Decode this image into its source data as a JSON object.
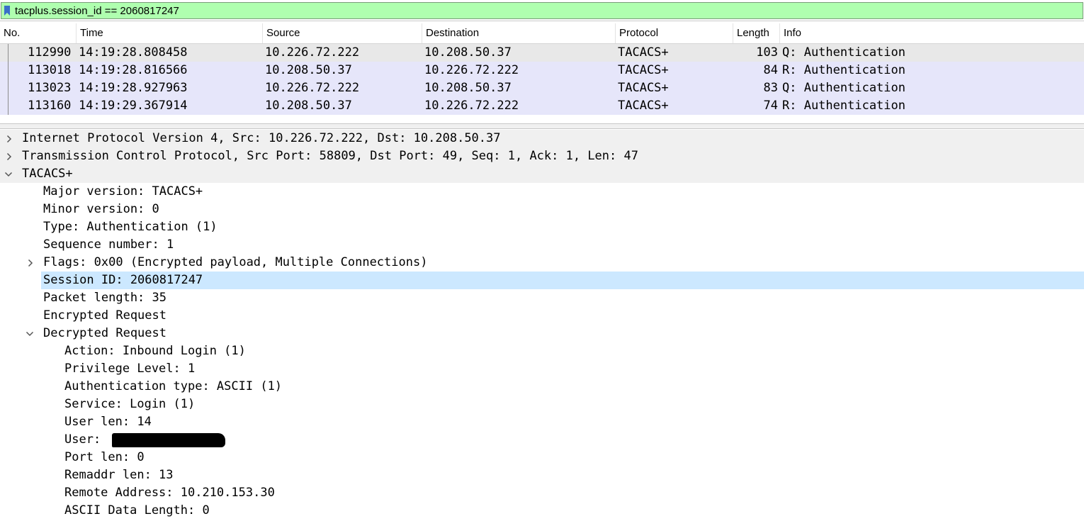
{
  "filter": {
    "text": "tacplus.session_id == 2060817247",
    "background": "#afffaf"
  },
  "columns": [
    "No.",
    "Time",
    "Source",
    "Destination",
    "Protocol",
    "Length",
    "Info"
  ],
  "packets": [
    {
      "no": "112990",
      "time": "14:19:28.808458",
      "source": "10.226.72.222",
      "destination": "10.208.50.37",
      "protocol": "TACACS+",
      "length": "103",
      "info": "Q: Authentication"
    },
    {
      "no": "113018",
      "time": "14:19:28.816566",
      "source": "10.208.50.37",
      "destination": "10.226.72.222",
      "protocol": "TACACS+",
      "length": "84",
      "info": "R: Authentication"
    },
    {
      "no": "113023",
      "time": "14:19:28.927963",
      "source": "10.226.72.222",
      "destination": "10.208.50.37",
      "protocol": "TACACS+",
      "length": "83",
      "info": "Q: Authentication"
    },
    {
      "no": "113160",
      "time": "14:19:29.367914",
      "source": "10.208.50.37",
      "destination": "10.226.72.222",
      "protocol": "TACACS+",
      "length": "74",
      "info": "R: Authentication"
    }
  ],
  "row_colors": {
    "selected": "#e8e8e8",
    "tacacs": "#e6e6fa",
    "highlight": "#cce8ff"
  },
  "details": {
    "ip": "Internet Protocol Version 4, Src: 10.226.72.222, Dst: 10.208.50.37",
    "tcp": "Transmission Control Protocol, Src Port: 58809, Dst Port: 49, Seq: 1, Ack: 1, Len: 47",
    "tacacs": "TACACS+",
    "major": "Major version: TACACS+",
    "minor": "Minor version: 0",
    "type": "Type: Authentication (1)",
    "seq": "Sequence number: 1",
    "flags": "Flags: 0x00 (Encrypted payload, Multiple Connections)",
    "session": "Session ID: 2060817247",
    "packet_length": "Packet length: 35",
    "encrypted": "Encrypted Request",
    "decrypted": "Decrypted Request",
    "action": "Action: Inbound Login (1)",
    "priv": "Privilege Level: 1",
    "authtype": "Authentication type: ASCII (1)",
    "service": "Service: Login (1)",
    "userlen": "User len: 14",
    "user": "User:",
    "portlen": "Port len: 0",
    "remlen": "Remaddr len: 13",
    "remaddr": "Remote Address: 10.210.153.30",
    "asciilen": "ASCII Data Length: 0"
  }
}
